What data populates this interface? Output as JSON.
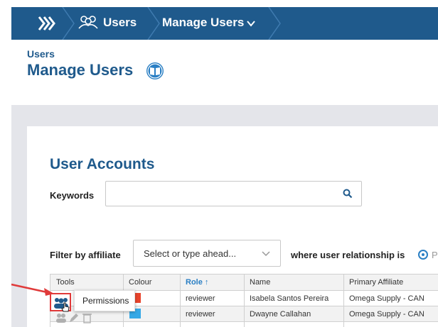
{
  "nav": {
    "users_label": "Users",
    "manage_label": "Manage Users",
    "home_icon": "double-chevron-right-icon",
    "users_icon": "people-outline-icon",
    "manage_chevron_icon": "chevron-down-icon",
    "bar_color": "#1f5a8c"
  },
  "header": {
    "breadcrumb": "Users",
    "title": "Manage Users",
    "help_icon": "book-icon"
  },
  "accounts": {
    "title": "User Accounts",
    "keywords_label": "Keywords",
    "keywords_value": "",
    "search_icon": "search-icon",
    "filter_label": "Filter by affiliate",
    "affiliate_placeholder": "Select or type ahead...",
    "relationship_label": "where user relationship is",
    "relationship_option_visible": "P"
  },
  "table": {
    "headers": [
      "Tools",
      "Colour",
      "Role ↑",
      "Name",
      "Primary Affiliate"
    ],
    "rows": [
      {
        "role": "reviewer",
        "name": "Isabela Santos Pereira",
        "affiliate": "Omega Supply - CAN",
        "colour": "#e8442c"
      },
      {
        "role": "reviewer",
        "name": "Dwayne Callahan",
        "affiliate": "Omega Supply - CAN",
        "colour": "#35a8e6"
      }
    ]
  },
  "tooltip": {
    "text": "Permissions"
  },
  "colors": {
    "accent": "#1f5a8c",
    "link": "#2a7fc4",
    "highlight": "#e03a3a",
    "background": "#e4e5ea"
  }
}
